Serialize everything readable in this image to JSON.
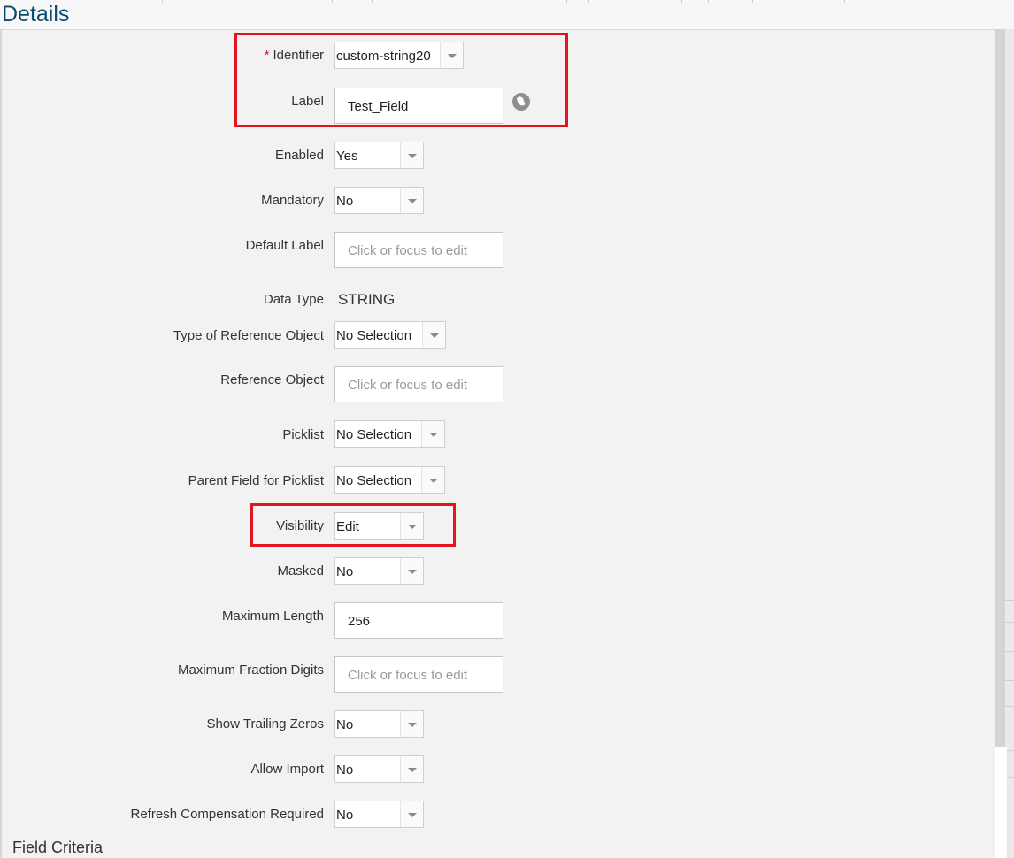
{
  "page": {
    "title": "Details"
  },
  "fields": {
    "identifier": {
      "label": "Identifier",
      "required_mark": "*",
      "value": "custom-string20"
    },
    "label": {
      "label": "Label",
      "value": "Test_Field",
      "icon": "globe-icon"
    },
    "enabled": {
      "label": "Enabled",
      "value": "Yes"
    },
    "mandatory": {
      "label": "Mandatory",
      "value": "No"
    },
    "default_label": {
      "label": "Default Label",
      "placeholder": "Click or focus to edit"
    },
    "data_type": {
      "label": "Data Type",
      "value": "STRING"
    },
    "type_of_reference_object": {
      "label": "Type of Reference Object",
      "value": "No Selection"
    },
    "reference_object": {
      "label": "Reference Object",
      "placeholder": "Click or focus to edit"
    },
    "picklist": {
      "label": "Picklist",
      "value": "No Selection"
    },
    "parent_field_for_picklist": {
      "label": "Parent Field for Picklist",
      "value": "No Selection"
    },
    "visibility": {
      "label": "Visibility",
      "value": "Edit"
    },
    "masked": {
      "label": "Masked",
      "value": "No"
    },
    "maximum_length": {
      "label": "Maximum Length",
      "value": "256"
    },
    "maximum_fraction_digits": {
      "label": "Maximum Fraction Digits",
      "placeholder": "Click or focus to edit"
    },
    "show_trailing_zeros": {
      "label": "Show Trailing Zeros",
      "value": "No"
    },
    "allow_import": {
      "label": "Allow Import",
      "value": "No"
    },
    "refresh_compensation_required": {
      "label": "Refresh Compensation Required",
      "value": "No"
    }
  },
  "sections": {
    "field_criteria": "Field Criteria"
  },
  "colors": {
    "title": "#0a4c6e",
    "highlight": "#e3141b",
    "required": "#d32030",
    "background": "#f2f2f2"
  }
}
